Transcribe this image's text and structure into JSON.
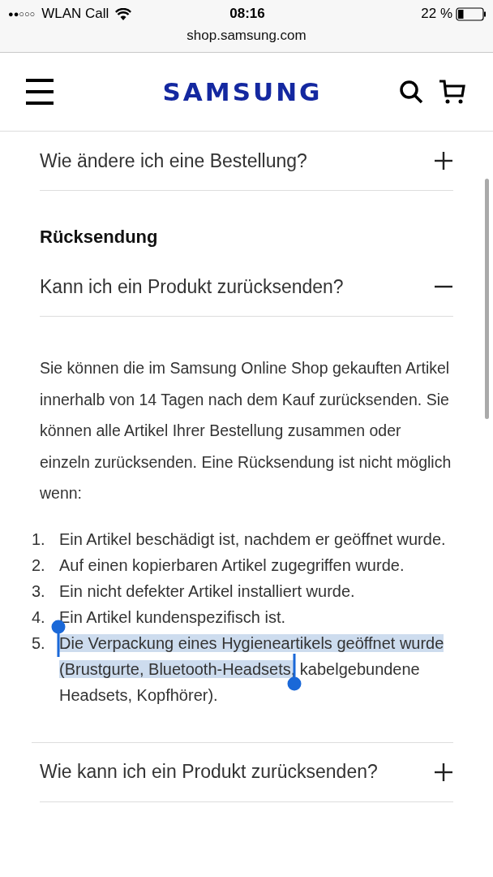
{
  "status_bar": {
    "signal_dots": "●●○○○",
    "carrier": "WLAN Call",
    "time": "08:16",
    "battery": "22 %"
  },
  "url_bar": {
    "url": "shop.samsung.com"
  },
  "header": {
    "logo": "SAMSUNG"
  },
  "faq_top": [
    {
      "question": "Wie ändere ich eine Bestellung?",
      "expanded": false
    }
  ],
  "section": {
    "title": "Rücksendung",
    "items": [
      {
        "question": "Kann ich ein Produkt zurücksenden?",
        "expanded": true,
        "answer": "Sie können die im Samsung Online Shop gekauften Artikel innerhalb von 14 Tagen nach dem Kauf zurücksenden. Sie können alle Artikel Ihrer Bestellung zusammen oder einzeln zurücksenden. Eine Rücksendung ist nicht möglich wenn:",
        "list": [
          {
            "number": "1.",
            "text": "Ein Artikel beschädigt ist, nachdem er geöffnet wurde."
          },
          {
            "number": "2.",
            "text": "Auf einen kopierbaren Artikel zugegriffen wurde."
          },
          {
            "number": "3.",
            "text": "Ein nicht defekter Artikel installiert wurde."
          },
          {
            "number": "4.",
            "text": "Ein Artikel kundenspezifisch ist."
          },
          {
            "number": "5.",
            "selected_text": "Die Verpackung eines Hygieneartikels geöffnet wurde (Brustgurte, Bluetooth-Headsets,",
            "text": " kabelgebundene Headsets, Kopfhörer)."
          }
        ]
      },
      {
        "question": "Wie kann ich ein Produkt zurücksenden?",
        "expanded": false
      }
    ]
  }
}
